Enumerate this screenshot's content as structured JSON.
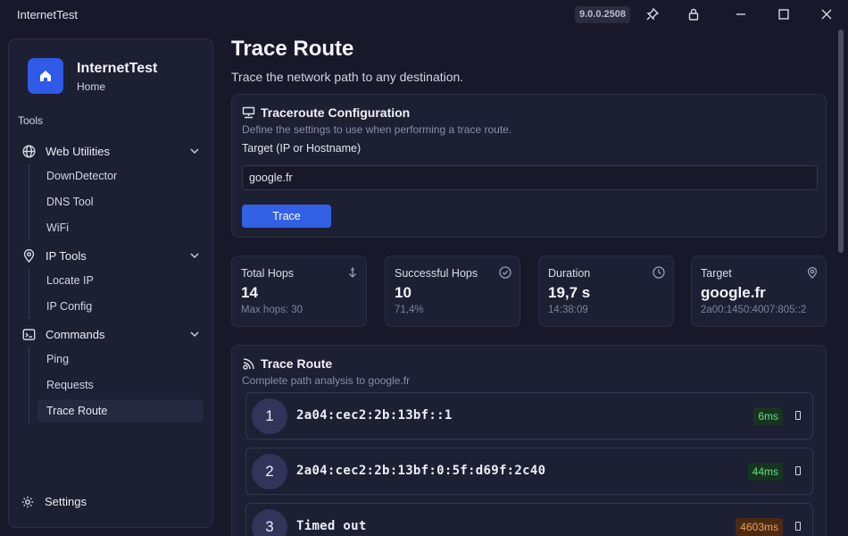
{
  "window": {
    "title": "InternetTest",
    "version": "9.0.0.2508"
  },
  "sidebar": {
    "app_name": "InternetTest",
    "app_sub": "Home",
    "section": "Tools",
    "groups": [
      {
        "label": "Web Utilities",
        "icon": "globe-icon",
        "items": [
          "DownDetector",
          "DNS Tool",
          "WiFi"
        ]
      },
      {
        "label": "IP Tools",
        "icon": "location-pin-icon",
        "items": [
          "Locate IP",
          "IP Config"
        ]
      },
      {
        "label": "Commands",
        "icon": "terminal-icon",
        "items": [
          "Ping",
          "Requests",
          "Trace Route"
        ]
      }
    ],
    "active_item": "Trace Route",
    "settings_label": "Settings"
  },
  "page": {
    "title": "Trace Route",
    "subtitle": "Trace the network path to any destination."
  },
  "config": {
    "title": "Traceroute Configuration",
    "description": "Define the settings to use when performing a trace route.",
    "target_label": "Target (IP or Hostname)",
    "target_value": "google.fr",
    "trace_button": "Trace"
  },
  "stats": [
    {
      "label": "Total Hops",
      "value": "14",
      "detail": "Max hops: 30",
      "icon": "arrow-down-icon"
    },
    {
      "label": "Successful Hops",
      "value": "10",
      "detail": "71,4%",
      "icon": "check-circle-icon"
    },
    {
      "label": "Duration",
      "value": "19,7 s",
      "detail": "14:38:09",
      "icon": "clock-icon"
    },
    {
      "label": "Target",
      "value": "google.fr",
      "detail": "2a00:1450:4007:805::2",
      "icon": "target-icon"
    }
  ],
  "results": {
    "title": "Trace Route",
    "description": "Complete path analysis to google.fr",
    "hops": [
      {
        "num": "1",
        "address": "2a04:cec2:2b:13bf::1",
        "time": "6ms",
        "status": "ok"
      },
      {
        "num": "2",
        "address": "2a04:cec2:2b:13bf:0:5f:d69f:2c40",
        "time": "44ms",
        "status": "ok"
      },
      {
        "num": "3",
        "address": "Timed out",
        "time": "4603ms",
        "status": "slow"
      }
    ]
  },
  "colors": {
    "accent": "#3361e6",
    "ok_text": "#5ee07c",
    "slow_text": "#f0a25a"
  }
}
